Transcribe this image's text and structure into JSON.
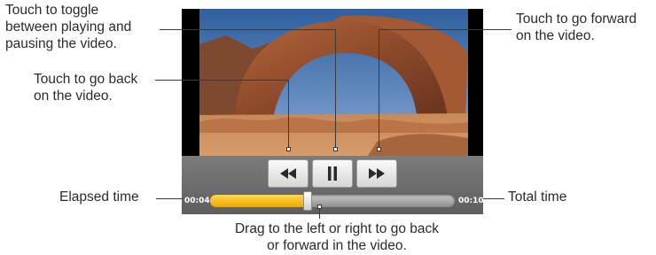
{
  "callouts": {
    "toggle": [
      "Touch to toggle",
      "between playing and",
      "pausing the video."
    ],
    "forward": [
      "Touch to go forward",
      "on the video."
    ],
    "back": [
      "Touch to go back",
      "on the video."
    ],
    "elapsed": "Elapsed time",
    "total": "Total time",
    "drag": [
      "Drag to the left or right to go back",
      "or forward in the video."
    ]
  },
  "player": {
    "elapsed_time": "00:04",
    "total_time": "00:10",
    "progress_fraction": 0.4
  },
  "icons": {
    "rewind": "rewind-icon",
    "pause": "pause-icon",
    "fast_forward": "fast-forward-icon"
  },
  "colors": {
    "progress_fill": "#f0a500",
    "track": "#8e8e8e",
    "controls_bar": "#5e5e5e"
  }
}
